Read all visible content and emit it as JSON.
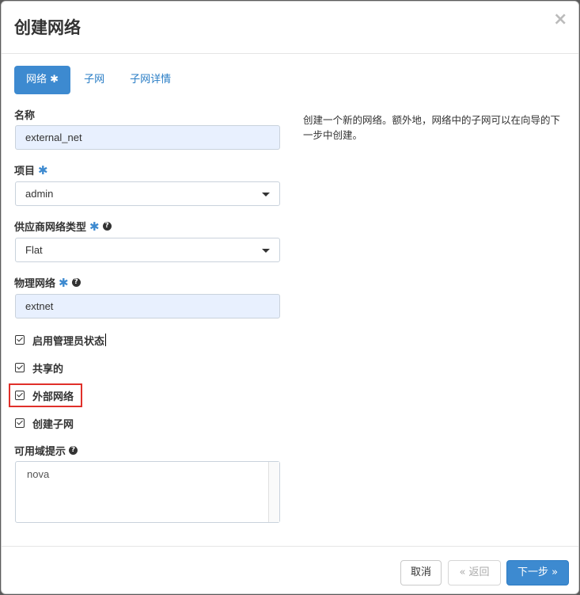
{
  "modal": {
    "title": "创建网络",
    "close_glyph": "×"
  },
  "tabs": [
    {
      "label": "网络",
      "required_mark": "✱",
      "active": true
    },
    {
      "label": "子网",
      "active": false
    },
    {
      "label": "子网详情",
      "active": false
    }
  ],
  "form": {
    "name": {
      "label": "名称",
      "value": "external_net"
    },
    "project": {
      "label": "项目",
      "required_mark": "✱",
      "value": "admin"
    },
    "provider_network_type": {
      "label": "供应商网络类型",
      "required_mark": "✱",
      "help_glyph": "?",
      "value": "Flat"
    },
    "physical_network": {
      "label": "物理网络",
      "required_mark": "✱",
      "help_glyph": "?",
      "value": "extnet"
    },
    "checkboxes": [
      {
        "label": "启用管理员状态",
        "checked": true
      },
      {
        "label": "共享的",
        "checked": true
      },
      {
        "label": "外部网络",
        "checked": true,
        "highlighted": true
      },
      {
        "label": "创建子网",
        "checked": true
      }
    ],
    "availability_zone_hints": {
      "label": "可用域提示",
      "help_glyph": "?",
      "options": [
        "nova"
      ]
    }
  },
  "description": "创建一个新的网络。额外地，网络中的子网可以在向导的下一步中创建。",
  "footer": {
    "cancel_label": "取消",
    "back_label": "« 返回",
    "next_label": "下一步 »"
  },
  "colors": {
    "primary": "#3d8ad0",
    "highlight_border": "#e0302a",
    "filled_input_bg": "#e8f0fe"
  }
}
